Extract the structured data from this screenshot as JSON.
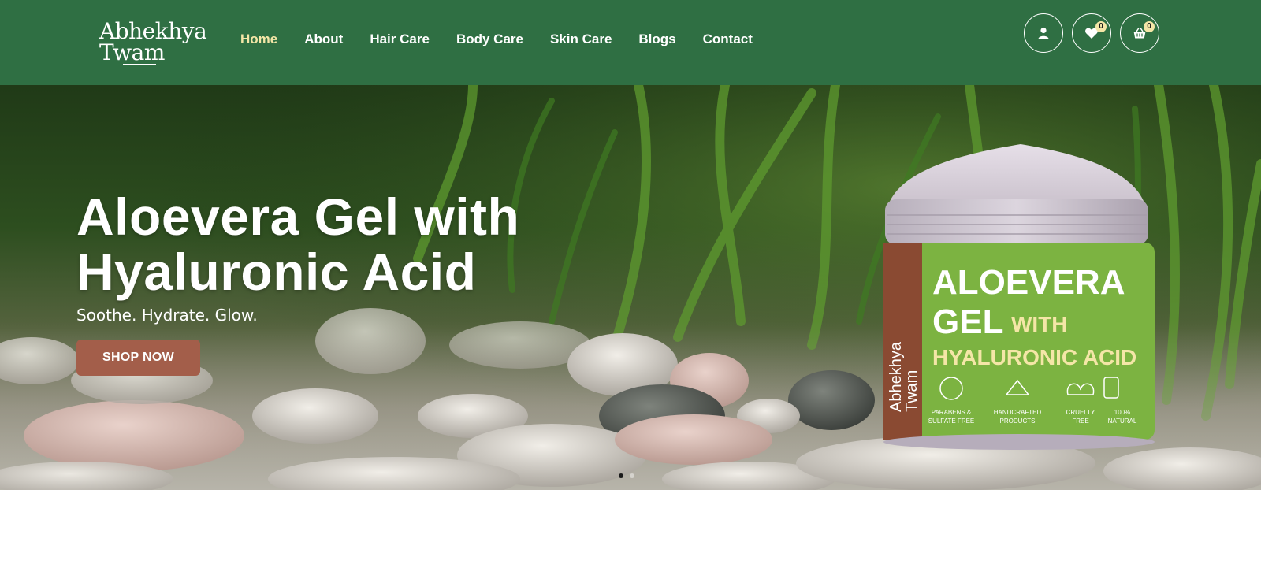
{
  "brand": {
    "line1": "Abhekhya",
    "line2": "Twam"
  },
  "nav": {
    "items": [
      {
        "label": "Home",
        "active": true
      },
      {
        "label": "About"
      },
      {
        "label": "Hair Care"
      },
      {
        "label": "Body Care"
      },
      {
        "label": "Skin Care"
      },
      {
        "label": "Blogs"
      },
      {
        "label": "Contact"
      }
    ]
  },
  "header_icons": {
    "account": {
      "icon": "user-icon"
    },
    "wishlist": {
      "icon": "heart-icon",
      "count": "0"
    },
    "cart": {
      "icon": "basket-icon",
      "count": "0"
    }
  },
  "hero": {
    "title_line1": "Aloevera Gel with",
    "title_line2": "Hyaluronic Acid",
    "subtitle": "Soothe. Hydrate. Glow.",
    "cta_label": "SHOP NOW",
    "slides_total": 2,
    "active_slide": 1,
    "product": {
      "brand_line1": "Abhekhya",
      "brand_line2": "Twam",
      "name_line1": "ALOEVERA",
      "name_line2a": "GEL",
      "name_line2b": "WITH",
      "name_line3": "HYALURONIC ACID",
      "badges": [
        {
          "line1": "PARABENS &",
          "line2": "SULFATE FREE"
        },
        {
          "line1": "HANDCRAFTED",
          "line2": "PRODUCTS"
        },
        {
          "line1": "CRUELTY",
          "line2": "FREE"
        },
        {
          "line1": "100%",
          "line2": "NATURAL"
        }
      ]
    }
  },
  "colors": {
    "header_bg": "#2f6f43",
    "nav_active": "#f4e6a7",
    "cta_bg": "#a35e4a",
    "jar_green": "#7cb341",
    "jar_brown": "#8a4a32"
  }
}
